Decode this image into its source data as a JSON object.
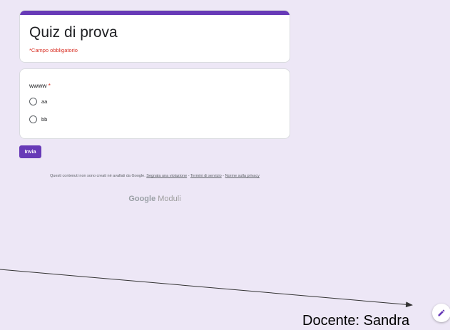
{
  "form": {
    "title": "Quiz di prova",
    "required_note": "*Campo obbligatorio",
    "question": {
      "title": "wwww",
      "required_mark": "*",
      "options": [
        "aa",
        "bb"
      ]
    },
    "submit_label": "Invia"
  },
  "footer": {
    "text": "Questi contenuti non sono creati né avallati da Google.",
    "link_report": "Segnala una violazione",
    "sep1": " - ",
    "link_terms": "Termini di servizio",
    "sep2": " - ",
    "link_privacy": "Norme sulla privacy"
  },
  "brand": {
    "google": "Google",
    "product": "Moduli"
  },
  "caption": "Docente: Sandra",
  "colors": {
    "accent": "#673ab7",
    "background": "#ede7f6",
    "required": "#d93025"
  },
  "icons": {
    "edit": "pencil-icon",
    "radio": "radio-unchecked-icon"
  }
}
